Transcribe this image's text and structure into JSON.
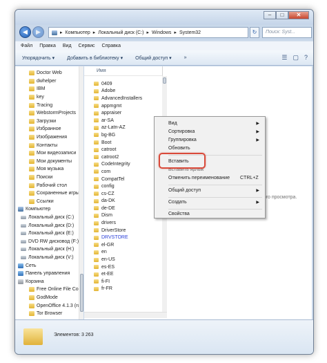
{
  "window": {
    "search_placeholder": "Поиск: Syst...",
    "buttons": {
      "minimize": "–",
      "maximize": "□",
      "close": "✕"
    }
  },
  "address": {
    "back": "◀",
    "forward": "▶",
    "segments": [
      "Компьютер",
      "Локальный диск (C:)",
      "Windows",
      "System32"
    ],
    "separator": "▸",
    "refresh": "↻"
  },
  "menubar": [
    "Файл",
    "Правка",
    "Вид",
    "Сервис",
    "Справка"
  ],
  "toolbar": {
    "organize": "Упорядочить ▾",
    "add_library": "Добавить в библиотеку ▾",
    "share": "Общий доступ ▾",
    "more": "»",
    "view_icon": "☰",
    "preview_icon": "▢",
    "help_icon": "?"
  },
  "nav": {
    "items": [
      {
        "label": "Doctor Web",
        "icon": "folder"
      },
      {
        "label": "dwhelper",
        "icon": "folder"
      },
      {
        "label": "IBM",
        "icon": "folder"
      },
      {
        "label": "key",
        "icon": "folder"
      },
      {
        "label": "Tracing",
        "icon": "folder"
      },
      {
        "label": "WebstormProjects",
        "icon": "folder"
      },
      {
        "label": "Загрузки",
        "icon": "folder"
      },
      {
        "label": "Избранное",
        "icon": "folder"
      },
      {
        "label": "Изображения",
        "icon": "folder"
      },
      {
        "label": "Контакты",
        "icon": "folder"
      },
      {
        "label": "Мои видеозаписи",
        "icon": "folder"
      },
      {
        "label": "Мои документы",
        "icon": "folder"
      },
      {
        "label": "Моя музыка",
        "icon": "folder"
      },
      {
        "label": "Поиски",
        "icon": "folder"
      },
      {
        "label": "Рабочий стол",
        "icon": "folder"
      },
      {
        "label": "Сохраненные игры",
        "icon": "folder"
      },
      {
        "label": "Ссылки",
        "icon": "folder"
      },
      {
        "label": "Компьютер",
        "icon": "computer"
      },
      {
        "label": "Локальный диск (C:)",
        "icon": "drive"
      },
      {
        "label": "Локальный диск (D:)",
        "icon": "drive"
      },
      {
        "label": "Локальный диск (E:)",
        "icon": "drive"
      },
      {
        "label": "DVD RW дисковод (F:)",
        "icon": "drive"
      },
      {
        "label": "Локальный диск (H:)",
        "icon": "drive"
      },
      {
        "label": "Локальный диск (V:)",
        "icon": "drive"
      },
      {
        "label": "Сеть",
        "icon": "network"
      },
      {
        "label": "Панель управления",
        "icon": "control-panel"
      },
      {
        "label": "Корзина",
        "icon": "recycle-bin"
      },
      {
        "label": "Free Online File Conv",
        "icon": "folder"
      },
      {
        "label": "GodMode",
        "icon": "folder"
      },
      {
        "label": "OpenOffice 4.1.3 (ru)",
        "icon": "folder"
      },
      {
        "label": "Tor Browser",
        "icon": "folder"
      }
    ]
  },
  "files": {
    "column_header": "Имя",
    "items": [
      {
        "name": "0409",
        "color": "#1e1e1e"
      },
      {
        "name": "Adobe",
        "color": "#1e1e1e"
      },
      {
        "name": "AdvancedInstallers",
        "color": "#1e1e1e"
      },
      {
        "name": "appmgmt",
        "color": "#1e1e1e"
      },
      {
        "name": "appraiser",
        "color": "#1e1e1e"
      },
      {
        "name": "ar-SA",
        "color": "#1e1e1e"
      },
      {
        "name": "az-Latn-AZ",
        "color": "#1e1e1e"
      },
      {
        "name": "bg-BG",
        "color": "#1e1e1e"
      },
      {
        "name": "Boot",
        "color": "#1e1e1e"
      },
      {
        "name": "catroot",
        "color": "#1e1e1e"
      },
      {
        "name": "catroot2",
        "color": "#1e1e1e"
      },
      {
        "name": "CodeIntegrity",
        "color": "#1e1e1e"
      },
      {
        "name": "com",
        "color": "#1e1e1e"
      },
      {
        "name": "CompatTel",
        "color": "#1e1e1e"
      },
      {
        "name": "config",
        "color": "#1e1e1e"
      },
      {
        "name": "cs-CZ",
        "color": "#1e1e1e"
      },
      {
        "name": "da-DK",
        "color": "#1e1e1e"
      },
      {
        "name": "de-DE",
        "color": "#1e1e1e"
      },
      {
        "name": "Dism",
        "color": "#1e1e1e"
      },
      {
        "name": "drivers",
        "color": "#1e1e1e"
      },
      {
        "name": "DriverStore",
        "color": "#1e1e1e"
      },
      {
        "name": "DRVSTORE",
        "color": "#2b40d8"
      },
      {
        "name": "el-GR",
        "color": "#1e1e1e"
      },
      {
        "name": "en",
        "color": "#1e1e1e"
      },
      {
        "name": "en-US",
        "color": "#1e1e1e"
      },
      {
        "name": "es-ES",
        "color": "#1e1e1e"
      },
      {
        "name": "et-EE",
        "color": "#1e1e1e"
      },
      {
        "name": "fi-FI",
        "color": "#1e1e1e"
      },
      {
        "name": "fr-FR",
        "color": "#1e1e1e"
      }
    ]
  },
  "preview_text": "...ного просмотра.",
  "status": {
    "count_text": "Элементов: 3 263"
  },
  "context_menu": {
    "view": "Вид",
    "sort": "Сортировка",
    "group": "Группировка",
    "refresh": "Обновить",
    "paste": "Вставить",
    "paste_shortcut": "Вставить ярлык",
    "undo_rename": "Отменить переименование",
    "undo_shortcut": "CTRL+Z",
    "share": "Общий доступ",
    "new": "Создать",
    "properties": "Свойства",
    "submenu_arrow": "▶"
  },
  "colors": {
    "highlight_border": "#d94a3a",
    "link_blue": "#2b40d8"
  }
}
